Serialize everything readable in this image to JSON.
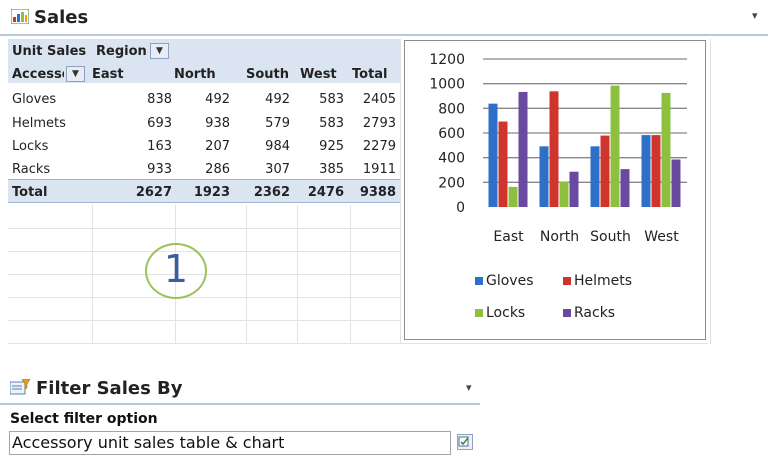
{
  "sales_webpart": {
    "title": "Sales",
    "menu_glyph": "▾",
    "icon": "excel-chart-icon"
  },
  "pivot": {
    "row_field_header": "Unit Sales",
    "column_field_header": "Region",
    "row_label_header": "Accesso",
    "columns": [
      "East",
      "North",
      "South",
      "West",
      "Total"
    ],
    "rows": [
      {
        "label": "Gloves",
        "values": [
          "838",
          "492",
          "492",
          "583",
          "2405"
        ]
      },
      {
        "label": "Helmets",
        "values": [
          "693",
          "938",
          "579",
          "583",
          "2793"
        ]
      },
      {
        "label": "Locks",
        "values": [
          "163",
          "207",
          "984",
          "925",
          "2279"
        ]
      },
      {
        "label": "Racks",
        "values": [
          "933",
          "286",
          "307",
          "385",
          "1911"
        ]
      }
    ],
    "total": {
      "label": "Total",
      "values": [
        "2627",
        "1923",
        "2362",
        "2476",
        "9388"
      ]
    },
    "dropdown_glyph": "▼"
  },
  "chart_data": {
    "type": "bar",
    "categories": [
      "East",
      "North",
      "South",
      "West"
    ],
    "series": [
      {
        "name": "Gloves",
        "color": "#2f6fc7",
        "values": [
          838,
          492,
          492,
          583
        ]
      },
      {
        "name": "Helmets",
        "color": "#d0352d",
        "values": [
          693,
          938,
          579,
          583
        ]
      },
      {
        "name": "Locks",
        "color": "#8fbf3f",
        "values": [
          163,
          207,
          984,
          925
        ]
      },
      {
        "name": "Racks",
        "color": "#6a4aa0",
        "values": [
          933,
          286,
          307,
          385
        ]
      }
    ],
    "ylim": [
      0,
      1200
    ],
    "yticks": [
      "0",
      "200",
      "400",
      "600",
      "800",
      "1000",
      "1200"
    ],
    "grid": true,
    "legend_position": "bottom"
  },
  "callout": {
    "number": "1"
  },
  "filter_webpart": {
    "title": "Filter Sales By",
    "menu_glyph": "▾",
    "label": "Select filter option",
    "selected_value": "Accessory unit sales table & chart",
    "icon": "filter-icon",
    "button_icon": "browse-icon"
  }
}
